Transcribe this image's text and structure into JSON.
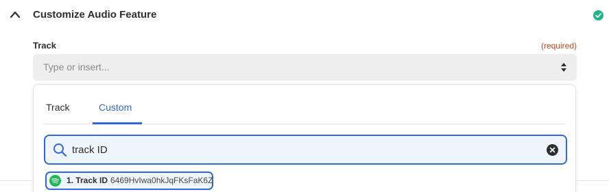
{
  "section": {
    "title": "Customize Audio Feature",
    "collapse_icon": "chevron-up-icon",
    "status_icon": "check-circle-icon",
    "status_color": "#21b487"
  },
  "field": {
    "label": "Track",
    "required_text": "(required)",
    "placeholder": "Type or insert...",
    "arrows_icon": "sort-arrows-icon"
  },
  "dropdown": {
    "tabs": [
      {
        "label": "Track",
        "active": false
      },
      {
        "label": "Custom",
        "active": true
      }
    ],
    "search": {
      "value": "track ID",
      "search_icon": "search-icon",
      "clear_icon": "clear-circle-icon"
    },
    "results": [
      {
        "label": "1. Track ID",
        "value": "6469HvIwa0hkJqFKsFaK6Z",
        "icon": "spotify-icon"
      }
    ]
  },
  "colors": {
    "accent": "#2f68d6",
    "required": "#c94418",
    "spotify": "#1db954"
  }
}
